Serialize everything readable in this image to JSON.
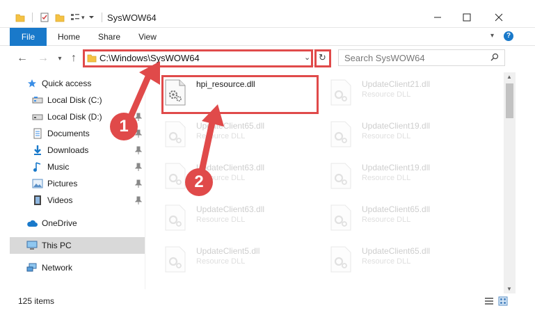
{
  "window": {
    "title": "SysWOW64"
  },
  "ribbon": {
    "tabs": [
      "File",
      "Home",
      "Share",
      "View"
    ]
  },
  "address_bar": {
    "path": "C:\\Windows\\SysWOW64",
    "search_placeholder": "Search SysWOW64"
  },
  "sidebar": {
    "items": [
      {
        "label": "Quick access",
        "icon": "star-icon"
      },
      {
        "label": "Local Disk (C:)",
        "icon": "drive-icon"
      },
      {
        "label": "Local Disk (D:)",
        "icon": "drive-icon"
      },
      {
        "label": "Documents",
        "icon": "documents-icon"
      },
      {
        "label": "Downloads",
        "icon": "download-icon"
      },
      {
        "label": "Music",
        "icon": "music-icon"
      },
      {
        "label": "Pictures",
        "icon": "pictures-icon"
      },
      {
        "label": "Videos",
        "icon": "videos-icon"
      },
      {
        "label": "OneDrive",
        "icon": "cloud-icon"
      },
      {
        "label": "This PC",
        "icon": "computer-icon"
      },
      {
        "label": "Network",
        "icon": "network-icon"
      }
    ]
  },
  "files": [
    {
      "name": "hpi_resource.dll",
      "type": ""
    },
    {
      "name": "UpdateClient21.dll",
      "type": "Resource DLL"
    },
    {
      "name": "UpdateClient65.dll",
      "type": "Resource DLL"
    },
    {
      "name": "UpdateClient19.dll",
      "type": "Resource DLL"
    },
    {
      "name": "UpdateClient63.dll",
      "type": "Resource DLL"
    },
    {
      "name": "UpdateClient19.dll",
      "type": "Resource DLL"
    },
    {
      "name": "UpdateClient63.dll",
      "type": "Resource DLL"
    },
    {
      "name": "UpdateClient65.dll",
      "type": "Resource DLL"
    },
    {
      "name": "UpdateClient5.dll",
      "type": "Resource DLL"
    },
    {
      "name": "UpdateClient65.dll",
      "type": "Resource DLL"
    }
  ],
  "status": {
    "item_count": "125 items"
  },
  "annotations": {
    "step1": "1",
    "step2": "2",
    "color": "#e04a4a"
  }
}
